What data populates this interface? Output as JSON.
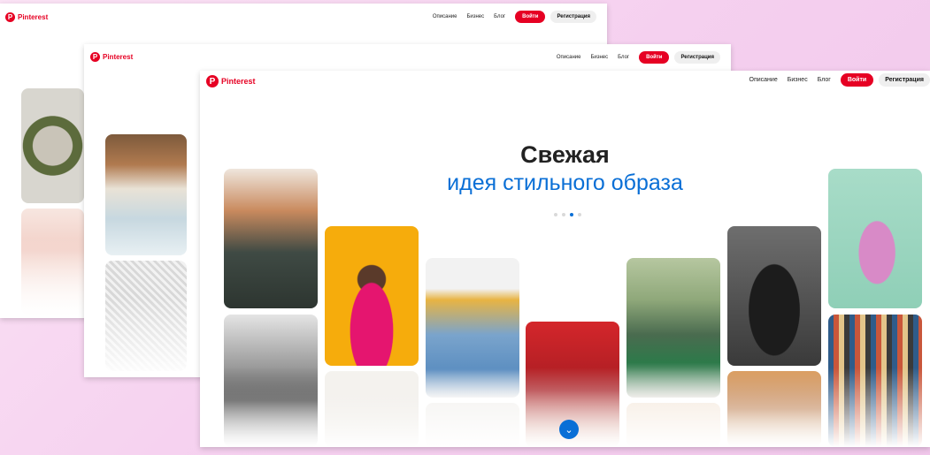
{
  "brand": {
    "name": "Pinterest",
    "logo_glyph": "P",
    "color": "#e60023"
  },
  "nav": {
    "about": "Описание",
    "business": "Бизнес",
    "blog": "Блог",
    "login": "Войти",
    "signup": "Регистрация"
  },
  "hero": {
    "line1": "Свежая",
    "line2": "идея стильного образа",
    "accent_color": "#0a6fd6",
    "carousel": {
      "count": 4,
      "active_index": 2
    }
  },
  "icons": {
    "scroll_down": "chevron-down-icon"
  }
}
